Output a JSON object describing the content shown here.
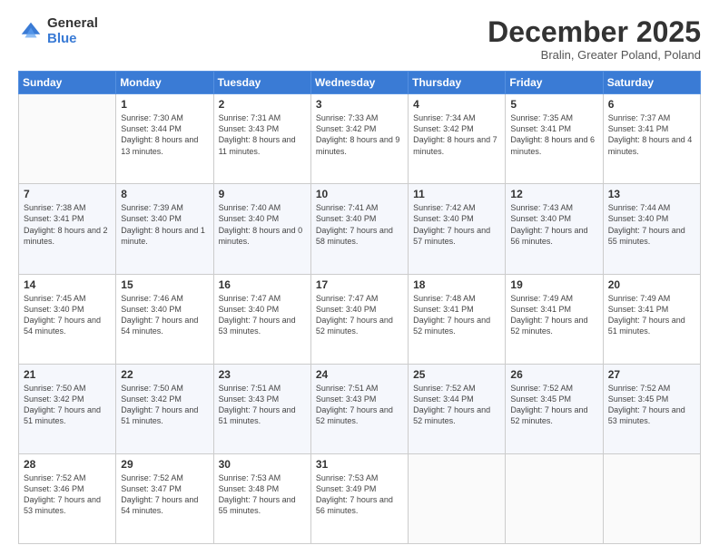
{
  "logo": {
    "general": "General",
    "blue": "Blue"
  },
  "title": "December 2025",
  "location": "Bralin, Greater Poland, Poland",
  "days_header": [
    "Sunday",
    "Monday",
    "Tuesday",
    "Wednesday",
    "Thursday",
    "Friday",
    "Saturday"
  ],
  "weeks": [
    [
      {
        "day": "",
        "sunrise": "",
        "sunset": "",
        "daylight": ""
      },
      {
        "day": "1",
        "sunrise": "Sunrise: 7:30 AM",
        "sunset": "Sunset: 3:44 PM",
        "daylight": "Daylight: 8 hours and 13 minutes."
      },
      {
        "day": "2",
        "sunrise": "Sunrise: 7:31 AM",
        "sunset": "Sunset: 3:43 PM",
        "daylight": "Daylight: 8 hours and 11 minutes."
      },
      {
        "day": "3",
        "sunrise": "Sunrise: 7:33 AM",
        "sunset": "Sunset: 3:42 PM",
        "daylight": "Daylight: 8 hours and 9 minutes."
      },
      {
        "day": "4",
        "sunrise": "Sunrise: 7:34 AM",
        "sunset": "Sunset: 3:42 PM",
        "daylight": "Daylight: 8 hours and 7 minutes."
      },
      {
        "day": "5",
        "sunrise": "Sunrise: 7:35 AM",
        "sunset": "Sunset: 3:41 PM",
        "daylight": "Daylight: 8 hours and 6 minutes."
      },
      {
        "day": "6",
        "sunrise": "Sunrise: 7:37 AM",
        "sunset": "Sunset: 3:41 PM",
        "daylight": "Daylight: 8 hours and 4 minutes."
      }
    ],
    [
      {
        "day": "7",
        "sunrise": "Sunrise: 7:38 AM",
        "sunset": "Sunset: 3:41 PM",
        "daylight": "Daylight: 8 hours and 2 minutes."
      },
      {
        "day": "8",
        "sunrise": "Sunrise: 7:39 AM",
        "sunset": "Sunset: 3:40 PM",
        "daylight": "Daylight: 8 hours and 1 minute."
      },
      {
        "day": "9",
        "sunrise": "Sunrise: 7:40 AM",
        "sunset": "Sunset: 3:40 PM",
        "daylight": "Daylight: 8 hours and 0 minutes."
      },
      {
        "day": "10",
        "sunrise": "Sunrise: 7:41 AM",
        "sunset": "Sunset: 3:40 PM",
        "daylight": "Daylight: 7 hours and 58 minutes."
      },
      {
        "day": "11",
        "sunrise": "Sunrise: 7:42 AM",
        "sunset": "Sunset: 3:40 PM",
        "daylight": "Daylight: 7 hours and 57 minutes."
      },
      {
        "day": "12",
        "sunrise": "Sunrise: 7:43 AM",
        "sunset": "Sunset: 3:40 PM",
        "daylight": "Daylight: 7 hours and 56 minutes."
      },
      {
        "day": "13",
        "sunrise": "Sunrise: 7:44 AM",
        "sunset": "Sunset: 3:40 PM",
        "daylight": "Daylight: 7 hours and 55 minutes."
      }
    ],
    [
      {
        "day": "14",
        "sunrise": "Sunrise: 7:45 AM",
        "sunset": "Sunset: 3:40 PM",
        "daylight": "Daylight: 7 hours and 54 minutes."
      },
      {
        "day": "15",
        "sunrise": "Sunrise: 7:46 AM",
        "sunset": "Sunset: 3:40 PM",
        "daylight": "Daylight: 7 hours and 54 minutes."
      },
      {
        "day": "16",
        "sunrise": "Sunrise: 7:47 AM",
        "sunset": "Sunset: 3:40 PM",
        "daylight": "Daylight: 7 hours and 53 minutes."
      },
      {
        "day": "17",
        "sunrise": "Sunrise: 7:47 AM",
        "sunset": "Sunset: 3:40 PM",
        "daylight": "Daylight: 7 hours and 52 minutes."
      },
      {
        "day": "18",
        "sunrise": "Sunrise: 7:48 AM",
        "sunset": "Sunset: 3:41 PM",
        "daylight": "Daylight: 7 hours and 52 minutes."
      },
      {
        "day": "19",
        "sunrise": "Sunrise: 7:49 AM",
        "sunset": "Sunset: 3:41 PM",
        "daylight": "Daylight: 7 hours and 52 minutes."
      },
      {
        "day": "20",
        "sunrise": "Sunrise: 7:49 AM",
        "sunset": "Sunset: 3:41 PM",
        "daylight": "Daylight: 7 hours and 51 minutes."
      }
    ],
    [
      {
        "day": "21",
        "sunrise": "Sunrise: 7:50 AM",
        "sunset": "Sunset: 3:42 PM",
        "daylight": "Daylight: 7 hours and 51 minutes."
      },
      {
        "day": "22",
        "sunrise": "Sunrise: 7:50 AM",
        "sunset": "Sunset: 3:42 PM",
        "daylight": "Daylight: 7 hours and 51 minutes."
      },
      {
        "day": "23",
        "sunrise": "Sunrise: 7:51 AM",
        "sunset": "Sunset: 3:43 PM",
        "daylight": "Daylight: 7 hours and 51 minutes."
      },
      {
        "day": "24",
        "sunrise": "Sunrise: 7:51 AM",
        "sunset": "Sunset: 3:43 PM",
        "daylight": "Daylight: 7 hours and 52 minutes."
      },
      {
        "day": "25",
        "sunrise": "Sunrise: 7:52 AM",
        "sunset": "Sunset: 3:44 PM",
        "daylight": "Daylight: 7 hours and 52 minutes."
      },
      {
        "day": "26",
        "sunrise": "Sunrise: 7:52 AM",
        "sunset": "Sunset: 3:45 PM",
        "daylight": "Daylight: 7 hours and 52 minutes."
      },
      {
        "day": "27",
        "sunrise": "Sunrise: 7:52 AM",
        "sunset": "Sunset: 3:45 PM",
        "daylight": "Daylight: 7 hours and 53 minutes."
      }
    ],
    [
      {
        "day": "28",
        "sunrise": "Sunrise: 7:52 AM",
        "sunset": "Sunset: 3:46 PM",
        "daylight": "Daylight: 7 hours and 53 minutes."
      },
      {
        "day": "29",
        "sunrise": "Sunrise: 7:52 AM",
        "sunset": "Sunset: 3:47 PM",
        "daylight": "Daylight: 7 hours and 54 minutes."
      },
      {
        "day": "30",
        "sunrise": "Sunrise: 7:53 AM",
        "sunset": "Sunset: 3:48 PM",
        "daylight": "Daylight: 7 hours and 55 minutes."
      },
      {
        "day": "31",
        "sunrise": "Sunrise: 7:53 AM",
        "sunset": "Sunset: 3:49 PM",
        "daylight": "Daylight: 7 hours and 56 minutes."
      },
      {
        "day": "",
        "sunrise": "",
        "sunset": "",
        "daylight": ""
      },
      {
        "day": "",
        "sunrise": "",
        "sunset": "",
        "daylight": ""
      },
      {
        "day": "",
        "sunrise": "",
        "sunset": "",
        "daylight": ""
      }
    ]
  ]
}
